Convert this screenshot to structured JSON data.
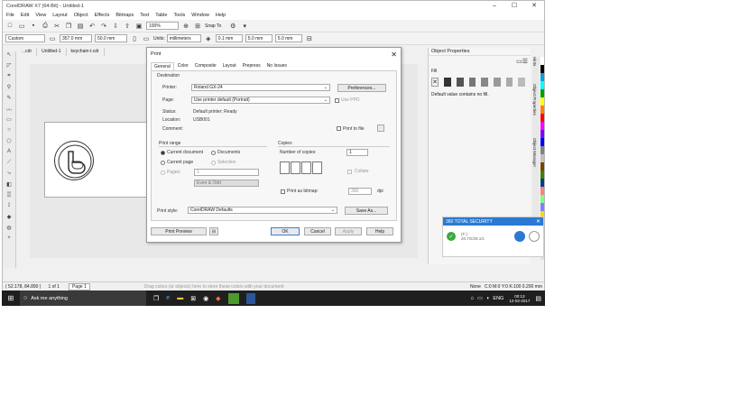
{
  "window": {
    "title": "CorelDRAW X7 (64-Bit) - Untitled-1",
    "min": "–",
    "max": "☐",
    "close": "✕"
  },
  "menu": [
    "File",
    "Edit",
    "View",
    "Layout",
    "Object",
    "Effects",
    "Bitmaps",
    "Text",
    "Table",
    "Tools",
    "Window",
    "Help"
  ],
  "toolbar": {
    "zoom": "100%",
    "snap": "Snap To"
  },
  "propbar": {
    "preset": "Custom",
    "width": "357.0 mm",
    "height": "50.0 mm",
    "units_label": "Units:",
    "units": "millimeters",
    "nudge": "0.1 mm",
    "dup_x": "5.0 mm",
    "dup_y": "5.0 mm"
  },
  "doc_tabs": [
    "...cdr",
    "Untitled-1",
    "keychain-t.cdr"
  ],
  "print": {
    "title": "Print",
    "close": "✕",
    "tabs": [
      "General",
      "Color",
      "Composite",
      "Layout",
      "Prepress",
      "No Issues"
    ],
    "destination": "Destination",
    "printer_label": "Printer:",
    "printer": "Roland GX-24",
    "preferences": "Preferences...",
    "page_label": "Page:",
    "page": "Use printer default (Portrait)",
    "use_ppd": "Use PPD",
    "status_label": "Status:",
    "status": "Default printer; Ready",
    "location_label": "Location:",
    "location": "USB001",
    "comment_label": "Comment:",
    "print_to_file": "Print to file",
    "print_range": "Print range",
    "current_document": "Current document",
    "documents": "Documents",
    "current_page": "Current page",
    "selection": "Selection",
    "pages_label": "Pages:",
    "pages": "1",
    "even_odd": "Even & Odd",
    "copies": "Copies",
    "num_copies_label": "Number of copies:",
    "num_copies": "1",
    "collate": "Collate",
    "print_as_bitmap": "Print as bitmap:",
    "dpi_value": "300",
    "dpi": "dpi",
    "print_style_label": "Print style:",
    "print_style": "CorelDRAW Defaults",
    "save_as": "Save As...",
    "print_preview": "Print Preview",
    "ok": "OK",
    "cancel": "Cancel",
    "apply": "Apply",
    "help": "Help"
  },
  "object_properties": {
    "title": "Object Properties",
    "fill_label": "Fill",
    "fill_msg": "Default value contains no fill."
  },
  "side_tabs": [
    "Hints",
    "Object Properties",
    "Object Manager"
  ],
  "status": {
    "coords": "( 52.178, 84.890 )",
    "page_of": "1 of 1",
    "page_tab": "Page 1",
    "hint": "Drag colors (or objects) here to store these colors with your document",
    "fill_none": "None",
    "color_info": "C:0 M:0 Y:0 K:100  0.200 mm"
  },
  "security": {
    "title": "360 TOTAL SECURITY",
    "drive": "(F:)",
    "size": "20.7G/29.1G"
  },
  "taskbar": {
    "search": "Ask me anything",
    "time": "00:13",
    "date": "12-02-2017",
    "lang": "ENG"
  },
  "palette": [
    "#ffffff",
    "#000000",
    "#00a0e0",
    "#00ffff",
    "#00a000",
    "#ffff00",
    "#ff8000",
    "#ff0000",
    "#ff00ff",
    "#8000ff",
    "#0000ff",
    "#808080",
    "#c0c0c0",
    "#804000",
    "#408000",
    "#004080",
    "#ff8080",
    "#80ff80",
    "#8080ff",
    "#ffd700",
    "#c0c0ff",
    "#a0a0a0",
    "#606060",
    "#303030",
    "#e0e0e0"
  ]
}
